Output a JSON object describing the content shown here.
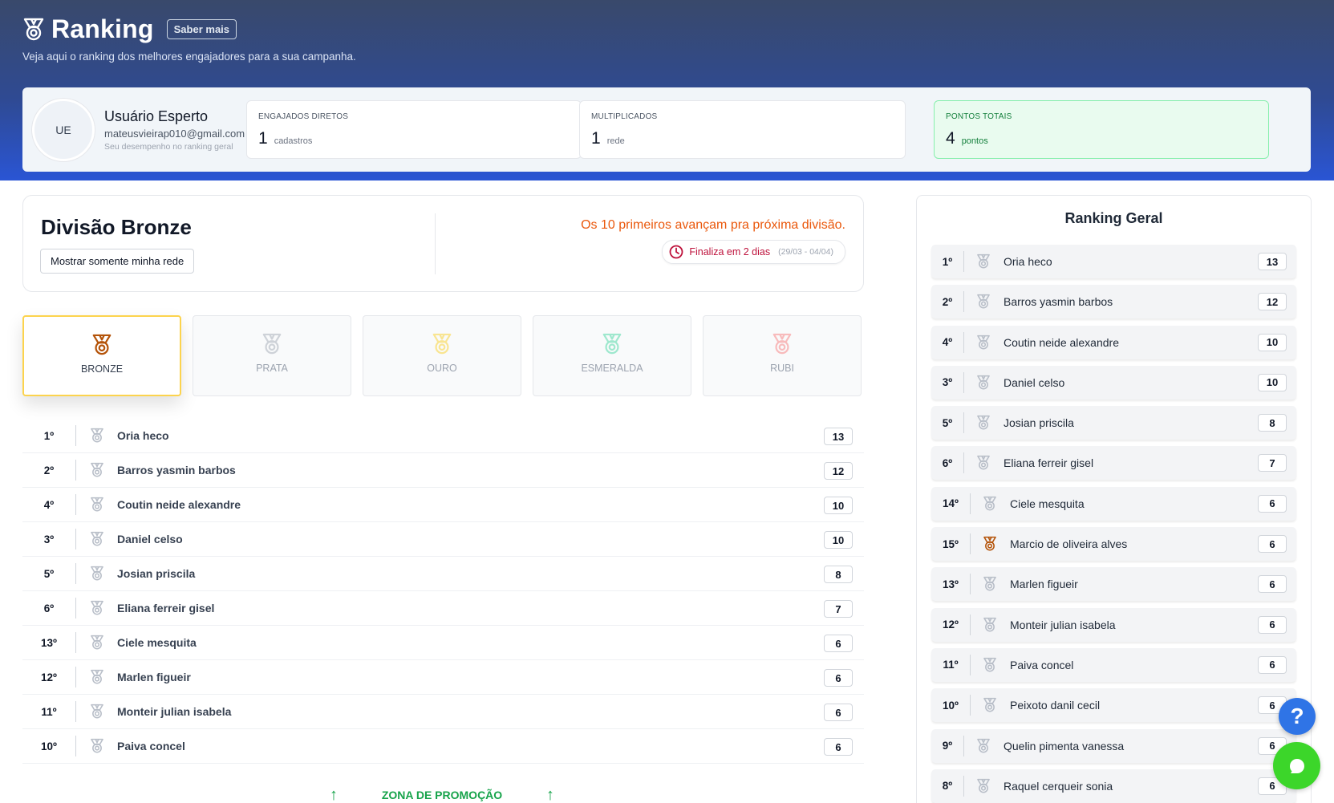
{
  "header": {
    "title": "Ranking",
    "saber_mais": "Saber mais",
    "subtitle": "Veja aqui o ranking dos melhores engajadores para a sua campanha."
  },
  "user": {
    "initials": "UE",
    "name": "Usuário Esperto",
    "email": "mateusvieirap010@gmail.com",
    "description": "Seu desempenho no ranking geral"
  },
  "stats": [
    {
      "label": "ENGAJADOS DIRETOS",
      "value": "1",
      "unit": "cadastros"
    },
    {
      "label": "MULTIPLICADOS",
      "value": "1",
      "unit": "rede"
    },
    {
      "label": "PONTOS TOTAIS",
      "value": "4",
      "unit": "pontos"
    }
  ],
  "division": {
    "title": "Divisão Bronze",
    "filter_button": "Mostrar somente minha rede",
    "promo_text": "Os 10 primeiros avançam pra próxima divisão.",
    "timer_text": "Finaliza em 2 dias",
    "timer_range": "(29/03 - 04/04)"
  },
  "tiers": [
    {
      "name": "BRONZE",
      "color": "#b45309",
      "active": true
    },
    {
      "name": "PRATA",
      "color": "#9ca3af",
      "active": false
    },
    {
      "name": "OURO",
      "color": "#facc15",
      "active": false
    },
    {
      "name": "ESMERALDA",
      "color": "#34d399",
      "active": false
    },
    {
      "name": "RUBI",
      "color": "#f87171",
      "active": false
    }
  ],
  "division_ranking": [
    {
      "pos": "1º",
      "name": "Oria heco",
      "points": "13"
    },
    {
      "pos": "2º",
      "name": "Barros yasmin barbos",
      "points": "12"
    },
    {
      "pos": "4º",
      "name": "Coutin neide alexandre",
      "points": "10"
    },
    {
      "pos": "3º",
      "name": "Daniel celso",
      "points": "10"
    },
    {
      "pos": "5º",
      "name": "Josian priscila",
      "points": "8"
    },
    {
      "pos": "6º",
      "name": "Eliana ferreir gisel",
      "points": "7"
    },
    {
      "pos": "13º",
      "name": "Ciele mesquita",
      "points": "6"
    },
    {
      "pos": "12º",
      "name": "Marlen figueir",
      "points": "6"
    },
    {
      "pos": "11º",
      "name": "Monteir julian isabela",
      "points": "6"
    },
    {
      "pos": "10º",
      "name": "Paiva concel",
      "points": "6"
    }
  ],
  "zone": {
    "label": "ZONA DE PROMOÇÃO"
  },
  "general_ranking": {
    "title": "Ranking Geral",
    "rows": [
      {
        "pos": "1º",
        "name": "Oria heco",
        "points": "13",
        "medal": "silver"
      },
      {
        "pos": "2º",
        "name": "Barros yasmin barbos",
        "points": "12",
        "medal": "silver"
      },
      {
        "pos": "4º",
        "name": "Coutin neide alexandre",
        "points": "10",
        "medal": "silver"
      },
      {
        "pos": "3º",
        "name": "Daniel celso",
        "points": "10",
        "medal": "silver"
      },
      {
        "pos": "5º",
        "name": "Josian priscila",
        "points": "8",
        "medal": "silver"
      },
      {
        "pos": "6º",
        "name": "Eliana ferreir gisel",
        "points": "7",
        "medal": "silver"
      },
      {
        "pos": "14º",
        "name": "Ciele mesquita",
        "points": "6",
        "medal": "silver"
      },
      {
        "pos": "15º",
        "name": "Marcio de oliveira alves",
        "points": "6",
        "medal": "bronze"
      },
      {
        "pos": "13º",
        "name": "Marlen figueir",
        "points": "6",
        "medal": "silver"
      },
      {
        "pos": "12º",
        "name": "Monteir julian isabela",
        "points": "6",
        "medal": "silver"
      },
      {
        "pos": "11º",
        "name": "Paiva concel",
        "points": "6",
        "medal": "silver"
      },
      {
        "pos": "10º",
        "name": "Peixoto danil cecil",
        "points": "6",
        "medal": "silver"
      },
      {
        "pos": "9º",
        "name": "Quelin pimenta vanessa",
        "points": "6",
        "medal": "silver"
      },
      {
        "pos": "8º",
        "name": "Raquel cerqueir sonia",
        "points": "6",
        "medal": "silver"
      }
    ]
  },
  "widgets": {
    "help_glyph": "?"
  },
  "colors": {
    "bronze": "#b45309",
    "silver": "#b8bec8",
    "promo": "#ea580c",
    "green": "#16a34a"
  }
}
